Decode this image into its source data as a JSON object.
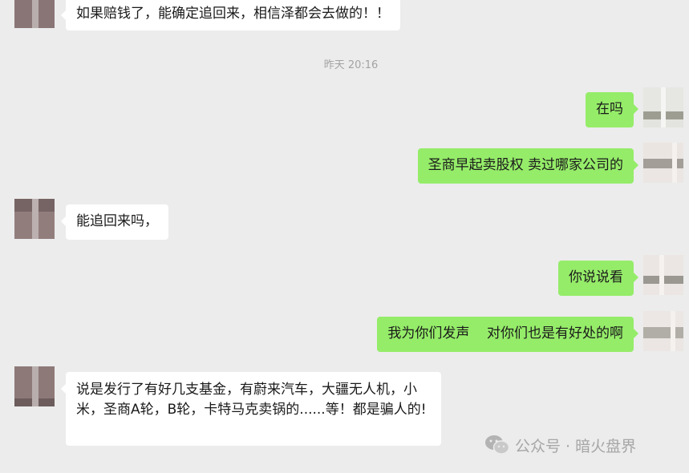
{
  "timestamp": "昨天 20:16",
  "messages": [
    {
      "side": "left",
      "text": "如果赔钱了，能确定追回来，相信泽都会去做的！！"
    },
    {
      "side": "right",
      "text": "在吗"
    },
    {
      "side": "right",
      "text": "圣商早起卖股权  卖过哪家公司的"
    },
    {
      "side": "left",
      "text": "能追回来吗，"
    },
    {
      "side": "right",
      "text": "你说说看"
    },
    {
      "side": "right",
      "text": "我为你们发声    对你们也是有好处的啊"
    },
    {
      "side": "left",
      "text": "说是发行了有好几支基金，有蔚来汽车，大疆无人机，小米，圣商A轮，B轮，卡特马克卖锅的......等！都是骗人的!"
    }
  ],
  "watermark": {
    "text": "公众号 · 暗火盘界",
    "icon": "wechat-icon"
  },
  "colors": {
    "background": "#ececec",
    "bubble_incoming": "#ffffff",
    "bubble_outgoing": "#95ec69",
    "timestamp_text": "#a3a3a3"
  }
}
